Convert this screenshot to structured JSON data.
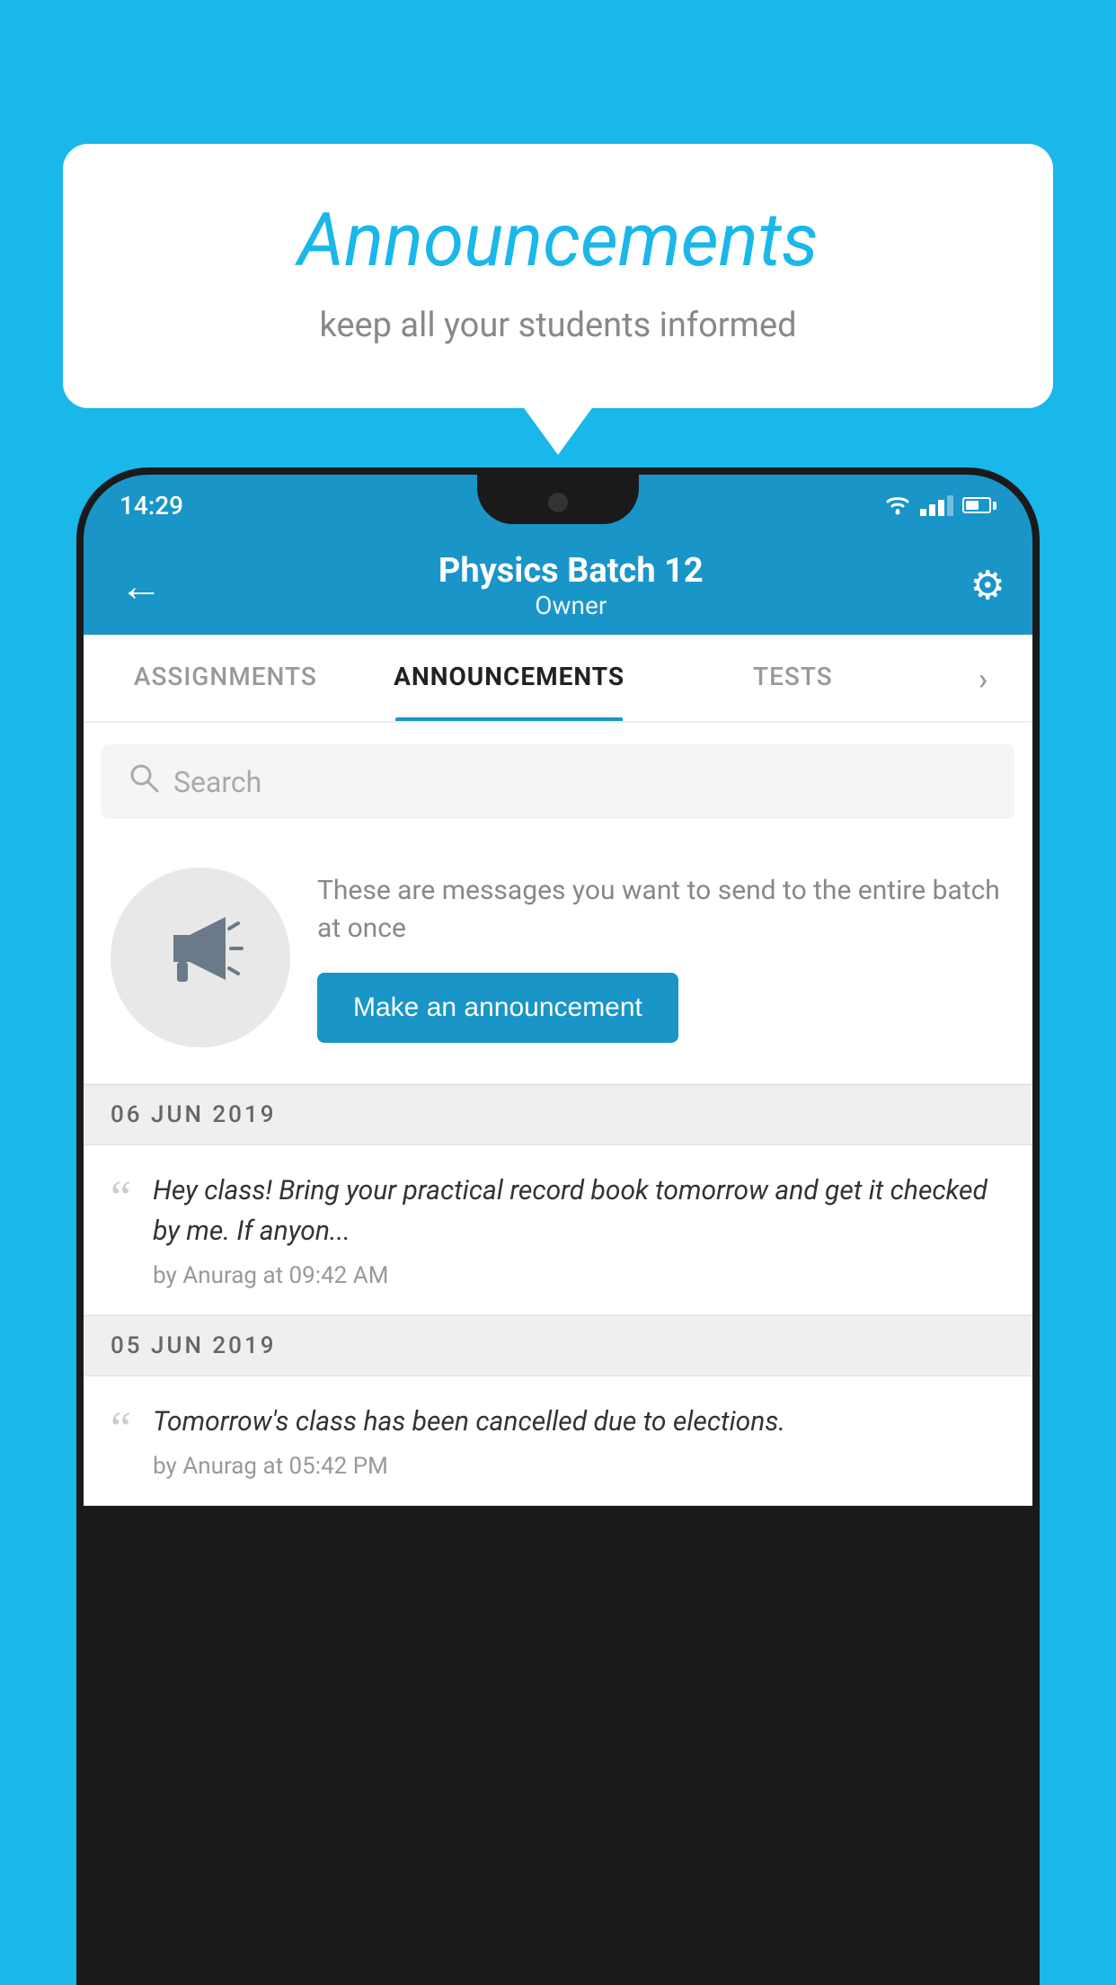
{
  "background_color": "#1ab7ea",
  "speech_bubble": {
    "title": "Announcements",
    "subtitle": "keep all your students informed"
  },
  "status_bar": {
    "time": "14:29"
  },
  "app_bar": {
    "title": "Physics Batch 12",
    "subtitle": "Owner",
    "back_label": "←",
    "gear_label": "⚙"
  },
  "tabs": [
    {
      "label": "ASSIGNMENTS",
      "active": false
    },
    {
      "label": "ANNOUNCEMENTS",
      "active": true
    },
    {
      "label": "TESTS",
      "active": false
    },
    {
      "label": "›",
      "active": false
    }
  ],
  "search": {
    "placeholder": "Search"
  },
  "promo": {
    "description": "These are messages you want to send to the entire batch at once",
    "button_label": "Make an announcement"
  },
  "announcements": [
    {
      "date_header": "06  JUN  2019",
      "text": "Hey class! Bring your practical record book tomorrow and get it checked by me. If anyon...",
      "meta": "by Anurag at 09:42 AM"
    },
    {
      "date_header": "05  JUN  2019",
      "text": "Tomorrow's class has been cancelled due to elections.",
      "meta": "by Anurag at 05:42 PM"
    }
  ]
}
